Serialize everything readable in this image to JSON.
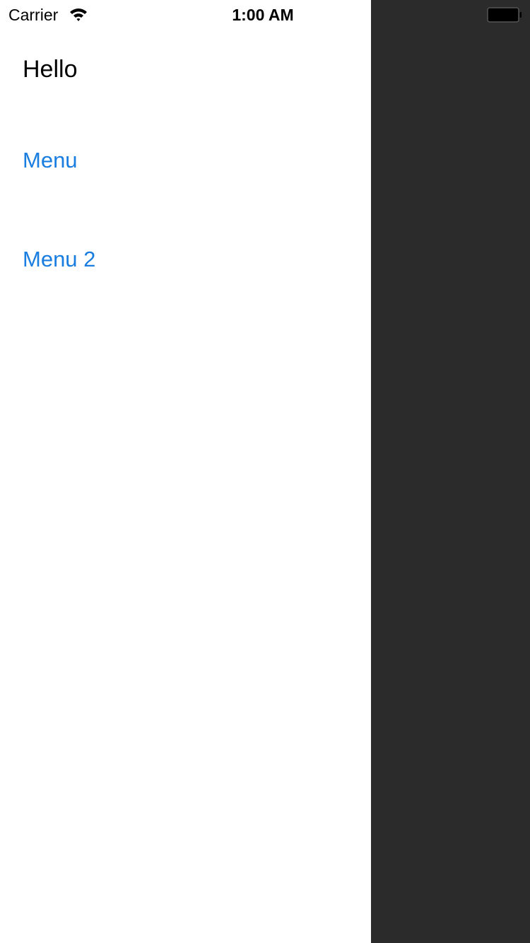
{
  "status_bar": {
    "carrier": "Carrier",
    "time": "1:00 AM",
    "wifi_icon": "wifi-icon",
    "battery_icon": "battery-icon"
  },
  "menu": {
    "heading": "Hello",
    "items": [
      {
        "label": "Menu"
      },
      {
        "label": "Menu 2"
      }
    ]
  },
  "colors": {
    "background": "#ffffff",
    "text": "#000000",
    "link": "#1a7de0",
    "main_content_overlay": "#2b2b2b"
  }
}
